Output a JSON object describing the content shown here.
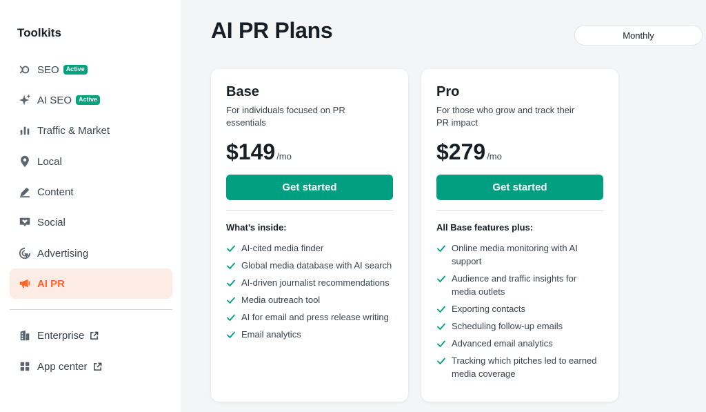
{
  "sidebar": {
    "title": "Toolkits",
    "items": [
      {
        "label": "SEO",
        "icon": "seo-icon",
        "badge": "Active"
      },
      {
        "label": "AI SEO",
        "icon": "sparkle-icon",
        "badge": "Active"
      },
      {
        "label": "Traffic & Market",
        "icon": "bar-chart-icon"
      },
      {
        "label": "Local",
        "icon": "map-pin-icon"
      },
      {
        "label": "Content",
        "icon": "pen-icon"
      },
      {
        "label": "Social",
        "icon": "chat-heart-icon"
      },
      {
        "label": "Advertising",
        "icon": "target-cursor-icon"
      },
      {
        "label": "AI PR",
        "icon": "megaphone-icon",
        "active": true
      }
    ],
    "bottom_items": [
      {
        "label": "Enterprise",
        "icon": "building-icon",
        "external": true
      },
      {
        "label": "App center",
        "icon": "grid-icon",
        "external": true
      }
    ]
  },
  "main": {
    "title": "AI PR Plans",
    "billing_toggle": "Monthly",
    "plans": [
      {
        "name": "Base",
        "description": "For individuals focused on PR essentials",
        "price": "$149",
        "unit": "/mo",
        "cta": "Get started",
        "features_title": "What’s inside:",
        "features": [
          "AI-cited media finder",
          "Global media database with AI search",
          "AI-driven journalist recommendations",
          "Media outreach tool",
          "AI for email and press release writing",
          "Email analytics"
        ]
      },
      {
        "name": "Pro",
        "description": "For those who grow and track their PR impact",
        "price": "$279",
        "unit": "/mo",
        "cta": "Get started",
        "features_title": "All Base features plus:",
        "features": [
          "Online media monitoring with AI support",
          "Audience and traffic insights for media outlets",
          "Exporting contacts",
          "Scheduling follow-up emails",
          "Advanced email analytics",
          "Tracking which pitches led to earned media coverage"
        ]
      }
    ]
  },
  "colors": {
    "accent": "#ff642d",
    "active_bg": "#fdece6",
    "cta": "#009f81",
    "badge": "#00a47c",
    "check": "#009f81"
  }
}
